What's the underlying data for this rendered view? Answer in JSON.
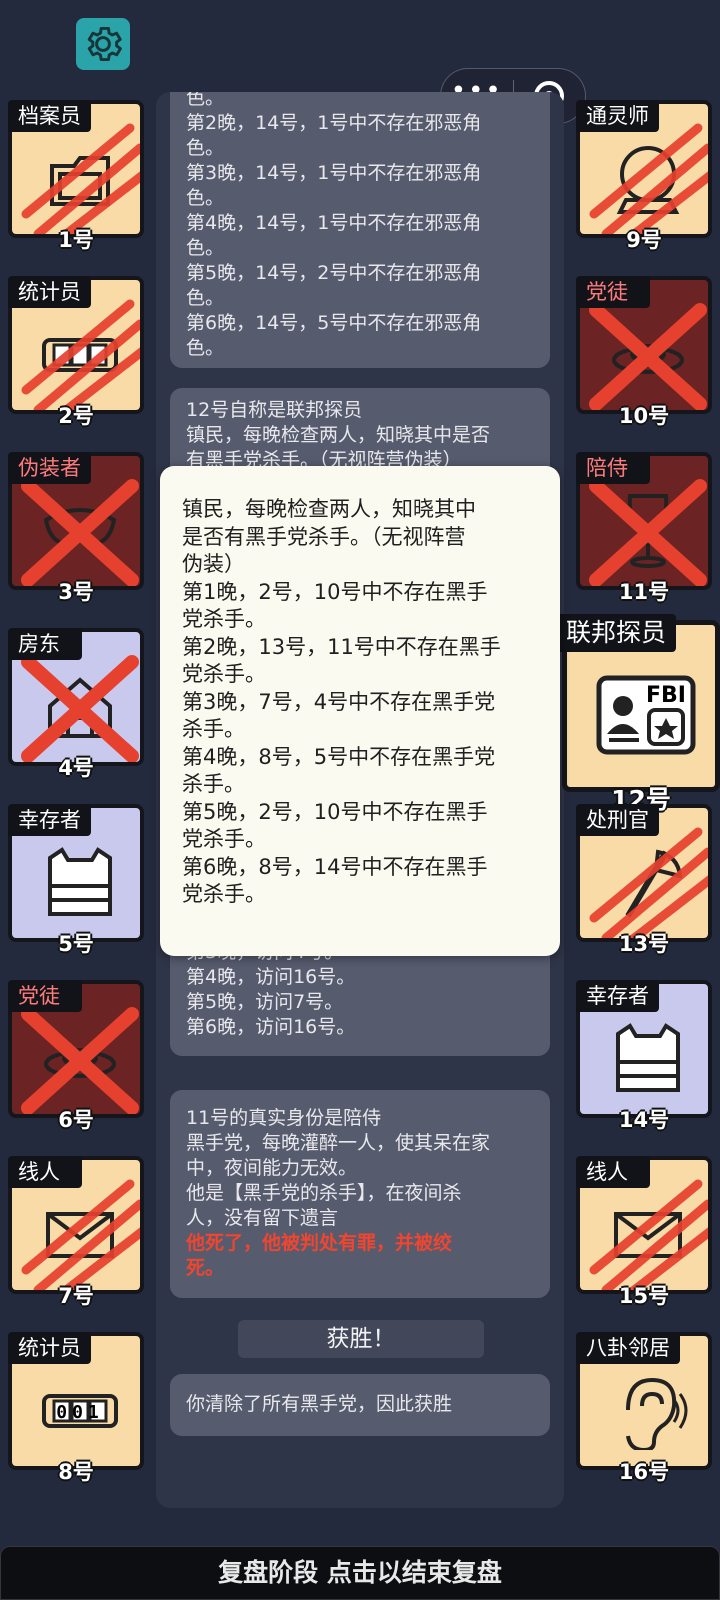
{
  "settings": {
    "icon": "gear-icon"
  },
  "capsule": {
    "menu_icon": "more-dots-icon",
    "close_icon": "target-circle-icon"
  },
  "log": {
    "card1": {
      "lines": "色。\n第2晚，14号，1号中不存在邪恶角\n色。\n第3晚，14号，1号中不存在邪恶角\n色。\n第4晚，14号，1号中不存在邪恶角\n色。\n第5晚，14号，2号中不存在邪恶角\n色。\n第6晚，14号，5号中不存在邪恶角\n色。"
    },
    "card2": {
      "lines": "12号自称是联邦探员\n镇民，每晚检查两人，知晓其中是否\n有黑手党杀手。（无视阵营伪装）"
    },
    "card3": {
      "lines": "第3晚，访问4号。\n第4晚，访问16号。\n第5晚，访问7号。\n第6晚，访问16号。"
    },
    "card4": {
      "lines": "11号的真实身份是陪侍\n黑手党，每晚灌醉一人，使其呆在家\n中，夜间能力无效。\n他是【黑手党的杀手】，在夜间杀\n人，没有留下遗言",
      "red_line": "他死了，他被判处有罪，并被绞\n死。"
    },
    "victory_label": "获胜！",
    "card5": {
      "lines": "你清除了所有黑手党，因此获胜"
    }
  },
  "popup": {
    "text": "镇民，每晚检查两人，知晓其中\n是否有黑手党杀手。（无视阵营\n伪装）\n第1晚，2号，10号中不存在黑手\n党杀手。\n第2晚，13号，11号中不存在黑手\n党杀手。\n第3晚，7号，4号中不存在黑手党\n杀手。\n第4晚，8号，5号中不存在黑手党\n杀手。\n第5晚，2号，10号中不存在黑手\n党杀手。\n第6晚，8号，14号中不存在黑手\n党杀手。"
  },
  "players": [
    {
      "num": "1号",
      "role": "档案员",
      "icon": "folder-icon",
      "status": "slashed",
      "bg": "beige"
    },
    {
      "num": "2号",
      "role": "统计员",
      "icon": "counter-icon",
      "status": "slashed",
      "bg": "beige"
    },
    {
      "num": "3号",
      "role": "伪装者",
      "icon": "mask-icon",
      "status": "crossed",
      "bg": "maroon"
    },
    {
      "num": "4号",
      "role": "房东",
      "icon": "house-icon",
      "status": "crossed",
      "bg": "lavender"
    },
    {
      "num": "5号",
      "role": "幸存者",
      "icon": "vest-icon",
      "status": "alive",
      "bg": "lavender"
    },
    {
      "num": "6号",
      "role": "党徒",
      "icon": "hat-icon",
      "status": "crossed",
      "bg": "maroon"
    },
    {
      "num": "7号",
      "role": "线人",
      "icon": "envelope-icon",
      "status": "slashed",
      "bg": "beige"
    },
    {
      "num": "8号",
      "role": "统计员",
      "icon": "counter-icon",
      "status": "alive",
      "bg": "beige",
      "counter": "001"
    },
    {
      "num": "9号",
      "role": "通灵师",
      "icon": "crystal-ball-icon",
      "status": "slashed",
      "bg": "beige"
    },
    {
      "num": "10号",
      "role": "党徒",
      "icon": "hat-icon",
      "status": "crossed",
      "bg": "maroon"
    },
    {
      "num": "11号",
      "role": "陪侍",
      "icon": "wine-glass-icon",
      "status": "crossed",
      "bg": "maroon"
    },
    {
      "num": "12号",
      "role": "联邦探员",
      "icon": "fbi-badge-icon",
      "status": "alive",
      "bg": "beige",
      "badge_text": "FBI"
    },
    {
      "num": "13号",
      "role": "处刑官",
      "icon": "axe-icon",
      "status": "slashed",
      "bg": "beige"
    },
    {
      "num": "14号",
      "role": "幸存者",
      "icon": "vest-icon",
      "status": "alive",
      "bg": "lavender"
    },
    {
      "num": "15号",
      "role": "线人",
      "icon": "envelope-icon",
      "status": "slashed",
      "bg": "beige"
    },
    {
      "num": "16号",
      "role": "八卦邻居",
      "icon": "ear-icon",
      "status": "alive",
      "bg": "beige"
    }
  ],
  "bottom_bar": {
    "label": "复盘阶段 点击以结束复盘"
  },
  "colors": {
    "background": "#242a3e",
    "dead_red": "#e63a2e",
    "alive_evil_label": "#ff7b7b"
  }
}
